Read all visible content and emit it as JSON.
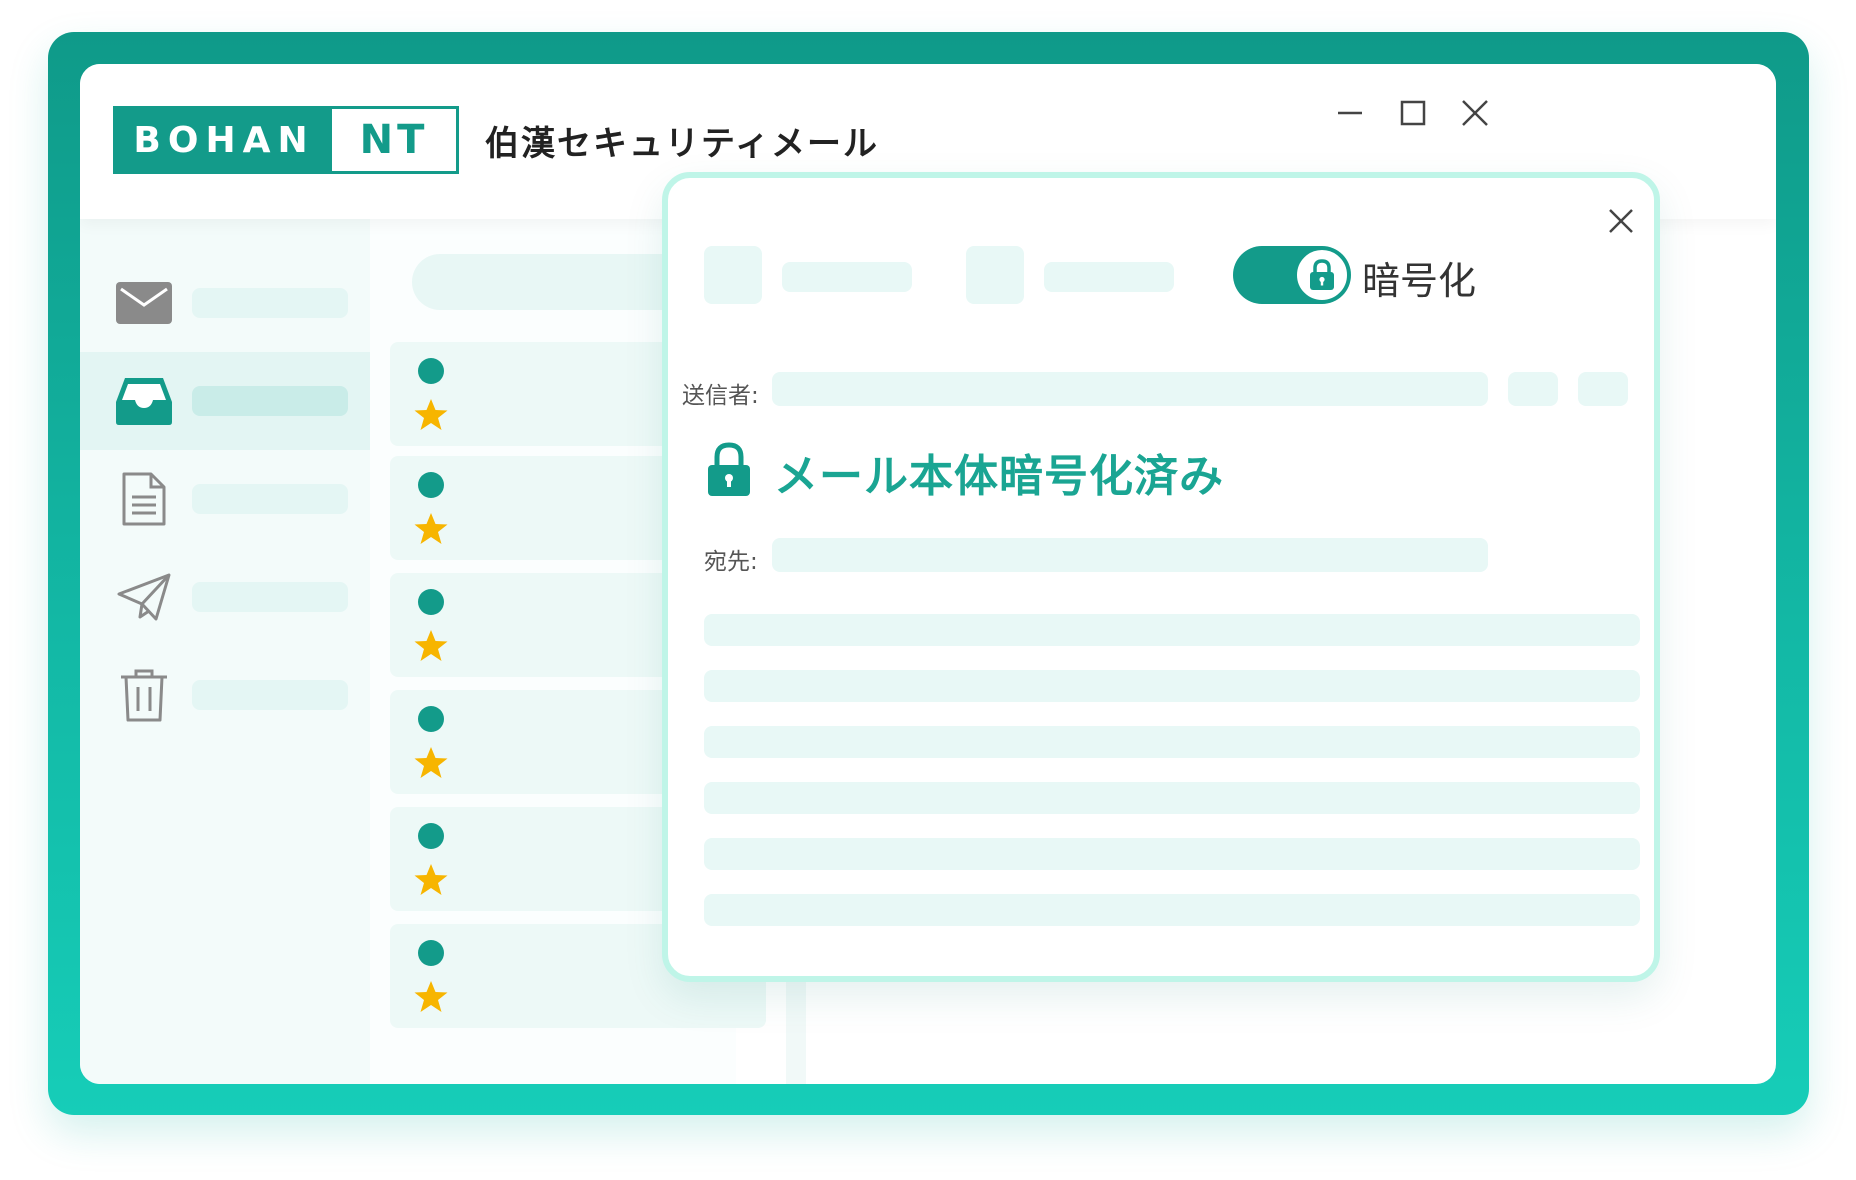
{
  "app": {
    "logo_left": "BOHAN",
    "logo_right": "NT",
    "title": "伯漢セキュリティメール"
  },
  "window_controls": [
    "minimize-icon",
    "maximize-icon",
    "close-icon"
  ],
  "sidebar": {
    "items": [
      {
        "icon": "mail-icon",
        "active": false
      },
      {
        "icon": "inbox-icon",
        "active": true
      },
      {
        "icon": "document-icon",
        "active": false
      },
      {
        "icon": "send-icon",
        "active": false
      },
      {
        "icon": "trash-icon",
        "active": false
      }
    ]
  },
  "mail_list": {
    "items": [
      {
        "unread": true,
        "starred": true
      },
      {
        "unread": true,
        "starred": true
      },
      {
        "unread": true,
        "starred": true
      },
      {
        "unread": true,
        "starred": true
      },
      {
        "unread": true,
        "starred": true
      },
      {
        "unread": true,
        "starred": true
      }
    ]
  },
  "dialog": {
    "encrypt_label": "暗号化",
    "encrypt_enabled": true,
    "sender_label": "送信者:",
    "encrypted_notice": "メール本体暗号化済み",
    "recipient_label": "宛先:"
  },
  "colors": {
    "accent": "#139b8a",
    "notice": "#1aa593",
    "star": "#f7b500",
    "placeholder": "#e8f8f6",
    "dialog_border": "#bff5e8"
  }
}
